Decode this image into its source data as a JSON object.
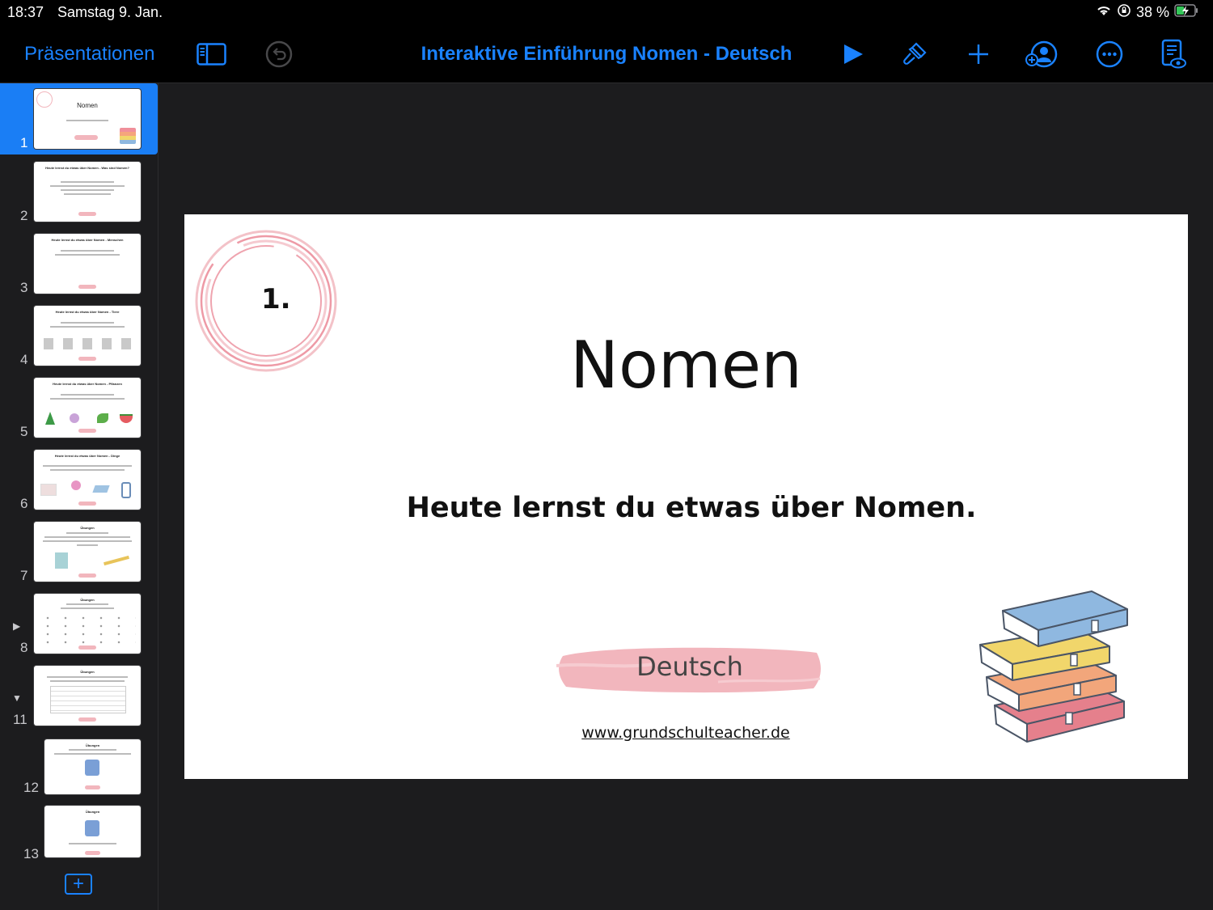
{
  "status": {
    "time": "18:37",
    "date": "Samstag 9. Jan.",
    "battery": "38 %"
  },
  "toolbar": {
    "back_label": "Präsentationen",
    "title": "Interaktive Einführung Nomen - Deutsch"
  },
  "colors": {
    "accent": "#1a82ff",
    "selected": "#1a7ef5",
    "brush": "#f2b6bd"
  },
  "thumbnails": [
    {
      "num": "1",
      "title": "Nomen",
      "selected": true
    },
    {
      "num": "2",
      "title": "Heute lernst du etwas über Nomen - Was sind Nomen?"
    },
    {
      "num": "3",
      "title": "Heute lernst du etwas über Nomen - Menschen"
    },
    {
      "num": "4",
      "title": "Heute lernst du etwas über Nomen - Tiere"
    },
    {
      "num": "5",
      "title": "Heute lernst du etwas über Nomen - Pflanzen"
    },
    {
      "num": "6",
      "title": "Heute lernst du etwas über Nomen - Dinge"
    },
    {
      "num": "7",
      "title": "Übungen"
    },
    {
      "num": "8",
      "title": "Übungen",
      "disclosure": "collapsed"
    },
    {
      "num": "11",
      "title": "Übungen",
      "disclosure": "expanded"
    },
    {
      "num": "12",
      "title": "Übungen"
    },
    {
      "num": "13",
      "title": "Übungen"
    }
  ],
  "slide": {
    "number": "1.",
    "title": "Nomen",
    "subtitle": "Heute lernst du etwas über Nomen.",
    "button_label": "Deutsch",
    "url": "www.grundschulteacher.de"
  }
}
